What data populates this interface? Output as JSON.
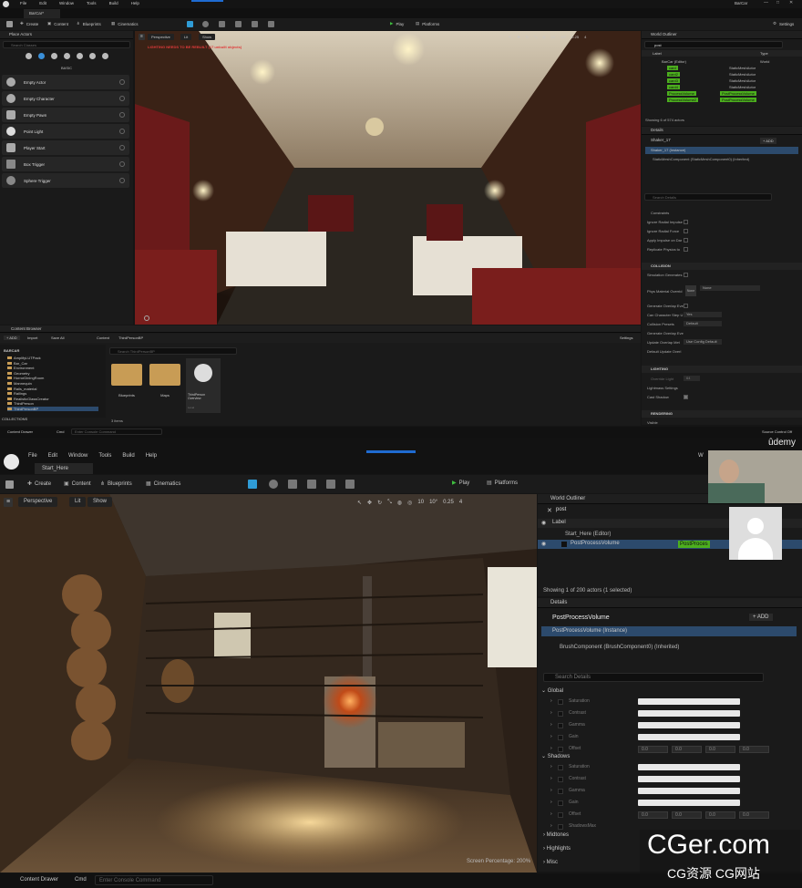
{
  "top": {
    "menu": [
      "File",
      "Edit",
      "Window",
      "Tools",
      "Build",
      "Help"
    ],
    "level_tab": "BarCar*",
    "project_title": "BarCar",
    "toolbar": {
      "save": "",
      "create": "Create",
      "content": "Content",
      "blueprints": "Blueprints",
      "cinematics": "Cinematics",
      "play": "Play",
      "platforms": "Platforms",
      "settings": "Settings"
    },
    "place_actors": {
      "title": "Place Actors",
      "search_placeholder": "Search Classes",
      "category": "BASIC",
      "items": [
        "Empty Actor",
        "Empty Character",
        "Empty Pawn",
        "Point Light",
        "Player Start",
        "Box Trigger",
        "Sphere Trigger"
      ]
    },
    "viewport": {
      "perspective": "Perspective",
      "lit": "Lit",
      "show": "Show",
      "warning": "LIGHTING NEEDS TO BE REBUILT (17 unbuilt objects)",
      "grid": "10",
      "angle": "10°",
      "scale": "0.25",
      "cam": "4"
    },
    "world_outliner": {
      "title": "World Outliner",
      "search": "post",
      "col_label": "Label",
      "col_type": "Type",
      "root": "BarCar (Editor)",
      "root_type": "World",
      "rows": [
        {
          "label": "card",
          "type": "StaticMeshActor"
        },
        {
          "label": "card2",
          "type": "StaticMeshActor"
        },
        {
          "label": "card3",
          "type": "StaticMeshActor"
        },
        {
          "label": "card4",
          "type": "StaticMeshActor"
        },
        {
          "label": "ProcessVolume",
          "type": "PostProcessVolume"
        },
        {
          "label": "ProcessVolume2",
          "type": "PostProcessVolume"
        }
      ],
      "status": "Showing 6 of 574 actors"
    },
    "details": {
      "title": "Details",
      "actor": "Shaker_17",
      "add": "+ ADD",
      "instance": "Shaker_17 (Instance)",
      "component": "StaticMeshComponent (StaticMeshComponent0) (Inherited)",
      "search_placeholder": "Search Details",
      "props": [
        "Constraints",
        "Ignore Radial Impulse",
        "Ignore Radial Force",
        "Apply Impulse on Dar",
        "Replicate Physics to"
      ],
      "collision_header": "COLLISION",
      "collision_props": [
        "Simulation Generates",
        "Phys Material Overrid",
        "Generate Overlap Eve",
        "Can Character Step U",
        "Collision Presets",
        "Generate Overlap Eve",
        "Update Overlap Met",
        "Default Update Overl"
      ],
      "none_label": "None",
      "yes_label": "Yes",
      "default_label": "Default",
      "use_config": "Use Config Default",
      "lighting_header": "LIGHTING",
      "lighting_props": [
        "Override Light",
        "Lightmass Settings",
        "Cast Shadow"
      ],
      "lighting_value": "64",
      "rendering_header": "RENDERING",
      "visible_label": "Visible"
    },
    "content_browser": {
      "title": "Content Browser",
      "add": "+ ADD",
      "import": "Import",
      "save_all": "Save All",
      "path": [
        "Content",
        "ThirdPersonBP"
      ],
      "settings": "Settings",
      "tree_root": "BARCAR",
      "tree": [
        "AmplifyLUTPack",
        "Bar_Car",
        "Environment",
        "Geometry",
        "HorrorDiningRoom",
        "Mannequin",
        "Rails_material",
        "Railings",
        "RealisticGlassCreator",
        "ThirdPerson",
        "ThirdPersonBP"
      ],
      "collections": "COLLECTIONS",
      "search_placeholder": "Search ThirdPersonBP",
      "assets": [
        {
          "name": "Blueprints"
        },
        {
          "name": "Maps"
        },
        {
          "name": "ThirdPerson Overview",
          "sub": "Level"
        }
      ],
      "count": "3 items"
    },
    "status": {
      "drawer": "Content Drawer",
      "cmd": "Cmd",
      "console_placeholder": "Enter Console Command",
      "source_control": "Source Control Off"
    }
  },
  "bottom": {
    "menu": [
      "File",
      "Edit",
      "Window",
      "Tools",
      "Build",
      "Help"
    ],
    "level_tab": "Start_Here",
    "welcome": "W",
    "udemy": "ûdemy",
    "toolbar": {
      "create": "Create",
      "content": "Content",
      "blueprints": "Blueprints",
      "cinematics": "Cinematics",
      "play": "Play",
      "platforms": "Platforms"
    },
    "viewport": {
      "perspective": "Perspective",
      "lit": "Lit",
      "show": "Show",
      "grid": "10",
      "angle": "10°",
      "scale": "0.25",
      "cam": "4",
      "screen_pct": "Screen Percentage: 200%"
    },
    "world_outliner": {
      "title": "World Outliner",
      "search": "post",
      "col_label": "Label",
      "root": "Start_Here (Editor)",
      "row_label": "PostProcessVolume",
      "row_type": "PostProces",
      "status": "Showing 1 of 200 actors (1 selected)"
    },
    "details": {
      "title": "Details",
      "actor": "PostProcessVolume",
      "add": "+ ADD",
      "instance": "PostProcessVolume (Instance)",
      "component": "BrushComponent (BrushComponent0) (Inherited)",
      "search_placeholder": "Search Details",
      "global": "Global",
      "global_props": [
        "Saturation",
        "Contrast",
        "Gamma",
        "Gain",
        "Offset"
      ],
      "shadows": "Shadows",
      "shadow_props": [
        "Saturation",
        "Contrast",
        "Gamma",
        "Gain",
        "Offset",
        "ShadowsMax"
      ],
      "offset_vals": [
        "0.0",
        "0.0",
        "0.0",
        "0.0"
      ],
      "midtones": "Midtones",
      "highlights": "Highlights",
      "misc": "Misc"
    },
    "status": {
      "drawer": "Content Drawer",
      "cmd": "Cmd",
      "console_placeholder": "Enter Console Command"
    }
  },
  "watermark": {
    "main": "CGer.com",
    "sub": "CG资源  CG网站"
  }
}
